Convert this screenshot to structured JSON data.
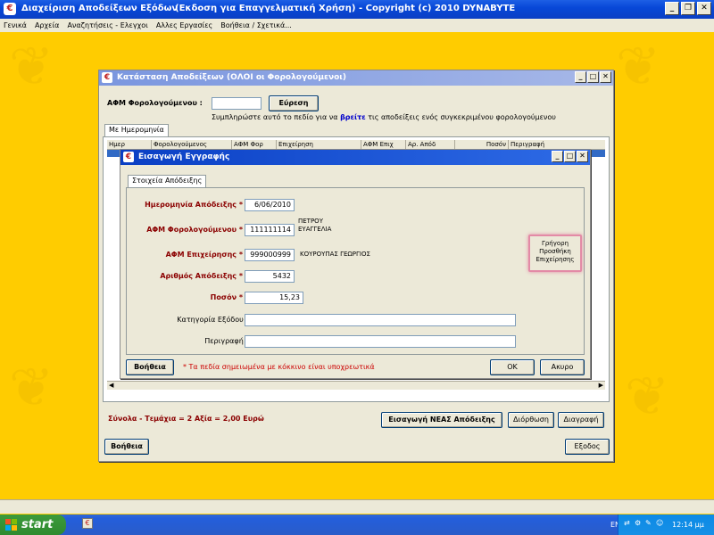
{
  "app": {
    "title": "Διαχείριση Αποδείξεων Εξόδων",
    "subtitle": "(Εκδοση για Επαγγελματική Χρήση)  -  Copyright (c)  2010 DYNABYTE"
  },
  "menu": [
    "Γενικά",
    "Αρχεία",
    "Αναζητήσεις - Ελεγχοι",
    "Αλλες Εργασίες",
    "Βοήθεια / Σχετικά..."
  ],
  "receipts_window": {
    "title": "Κατάσταση Αποδείξεων  (ΟΛΟΙ οι Φορολογούμενοι)",
    "afm_label": "ΑΦΜ Φορολογούμενου :",
    "afm_value": "",
    "search_button": "Εύρεση",
    "hint_pre": "Συμπληρώστε αυτό το πεδίο για να",
    "hint_link": "βρείτε",
    "hint_post": "τις αποδείξεις ενός συγκεκριμένου φορολογούμενου",
    "tab_by_date": "Με Ημερομηνία",
    "columns": [
      "Ημερ",
      "Φορολογούμενος",
      "ΑΦΜ Φορ",
      "Επιχείρηση",
      "ΑΦΜ Επιχ",
      "Αρ. Απόδ",
      "Ποσόν",
      "Περιγραφή"
    ],
    "totals": "Σύνολα  -  Τεμάχια = 2   Αξία = 2,00  Ευρώ",
    "add_new_button": "Εισαγωγή ΝΕΑΣ Απόδειξης",
    "edit_button": "Διόρθωση",
    "delete_button": "Διαγραφή",
    "help_button": "Βοήθεια",
    "exit_button": "Εξοδος"
  },
  "entry_dialog": {
    "title": "Εισαγωγή Εγγραφής",
    "tab": "Στοιχεία Απόδειξης",
    "date_label": "Ημερομηνία Απόδειξης * :",
    "date_value": "6/06/2010",
    "taxpayer_afm_label": "ΑΦΜ Φορολογούμενου * :",
    "taxpayer_afm_value": "111111114",
    "taxpayer_name_line1": "ΠΕΤΡΟΥ",
    "taxpayer_name_line2": "ΕΥΑΓΓΕΛΙΑ",
    "business_afm_label": "ΑΦΜ Επιχείρησης * :",
    "business_afm_value": "999000999",
    "business_name": "ΚΟΥΡΟΥΠΑΣ ΓΕΩΡΓΙΟΣ",
    "receipt_no_label": "Αριθμός Απόδειξης * :",
    "receipt_no_value": "5432",
    "amount_label": "Ποσόν * :",
    "amount_value": "15,23",
    "category_label": "Κατηγορία Εξόδου :",
    "category_value": "",
    "description_label": "Περιγραφή :",
    "description_value": "",
    "quick_add_line1": "Γρήγορη",
    "quick_add_line2": "Προσθήκη",
    "quick_add_line3": "Επιχείρησης",
    "help_button": "Βοήθεια",
    "required_note": "* Τα πεδία σημειωμένα με κόκκινο είναι υποχρεωτικά",
    "ok_button": "ΟΚ",
    "cancel_button": "Ακυρο"
  },
  "taskbar": {
    "start_label": "start",
    "lang": "EN",
    "clock": "12:14 μμ"
  },
  "colors": {
    "desktop": "#ffcc00",
    "required": "#8b0000",
    "link": "#0000cc"
  }
}
